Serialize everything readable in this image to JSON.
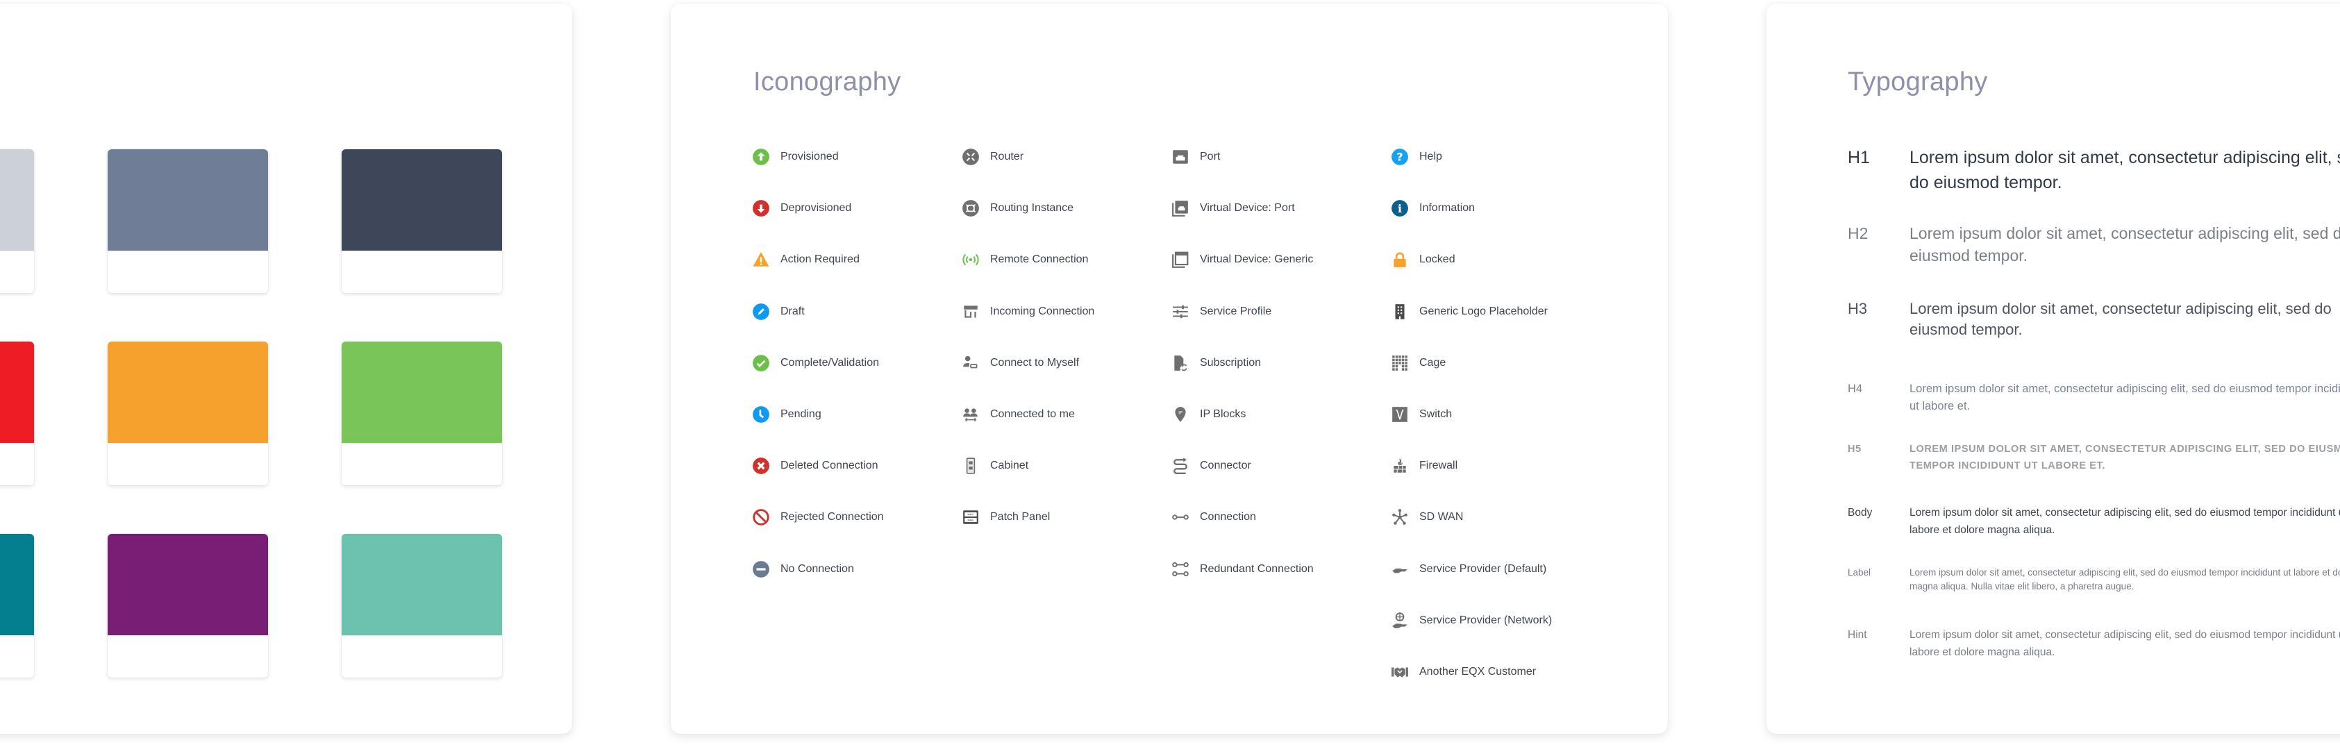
{
  "colors_panel": {
    "swatches": [
      {
        "name": "light-gray",
        "hex": "#CBD0D9"
      },
      {
        "name": "slate",
        "hex": "#6F7E96"
      },
      {
        "name": "dark-slate",
        "hex": "#3E4759"
      },
      {
        "name": "red",
        "hex": "#EE1C25"
      },
      {
        "name": "orange",
        "hex": "#F6A02D"
      },
      {
        "name": "green",
        "hex": "#7AC55A"
      },
      {
        "name": "teal",
        "hex": "#037F8F"
      },
      {
        "name": "purple",
        "hex": "#781E74"
      },
      {
        "name": "mint",
        "hex": "#6CC2AF"
      }
    ]
  },
  "iconography": {
    "title": "Iconography",
    "columns": [
      [
        {
          "label": "Provisioned",
          "icon": "arrow-up-circle-icon",
          "color": "#6CC04A"
        },
        {
          "label": "Deprovisioned",
          "icon": "arrow-down-circle-icon",
          "color": "#D0312D"
        },
        {
          "label": "Action Required",
          "icon": "warning-triangle-icon",
          "color": "#F7A128"
        },
        {
          "label": "Draft",
          "icon": "pencil-circle-icon",
          "color": "#0F9AF0"
        },
        {
          "label": "Complete/Validation",
          "icon": "check-circle-icon",
          "color": "#6CC04A"
        },
        {
          "label": "Pending",
          "icon": "clock-circle-icon",
          "color": "#0F9AF0"
        },
        {
          "label": "Deleted Connection",
          "icon": "x-circle-icon",
          "color": "#D0312D"
        },
        {
          "label": "Rejected Connection",
          "icon": "prohibited-icon",
          "color": "#D0312D"
        },
        {
          "label": "No Connection",
          "icon": "minus-circle-icon",
          "color": "#6B7A90"
        }
      ],
      [
        {
          "label": "Router",
          "icon": "router-icon",
          "color": "#6F6F6F"
        },
        {
          "label": "Routing Instance",
          "icon": "routing-instance-icon",
          "color": "#6F6F6F"
        },
        {
          "label": "Remote Connection",
          "icon": "broadcast-icon",
          "color": "#6CC04A"
        },
        {
          "label": "Incoming Connection",
          "icon": "storefront-icon",
          "color": "#6F6F6F"
        },
        {
          "label": "Connect to Myself",
          "icon": "user-loop-icon",
          "color": "#6F6F6F"
        },
        {
          "label": "Connected to me",
          "icon": "users-arrows-icon",
          "color": "#6F6F6F"
        },
        {
          "label": "Cabinet",
          "icon": "cabinet-icon",
          "color": "#6F6F6F"
        },
        {
          "label": "Patch Panel",
          "icon": "patch-panel-icon",
          "color": "#4A4A4A"
        }
      ],
      [
        {
          "label": "Port",
          "icon": "ethernet-port-icon",
          "color": "#6F6F6F"
        },
        {
          "label": "Virtual Device: Port",
          "icon": "virtual-port-icon",
          "color": "#6F6F6F"
        },
        {
          "label": "Virtual Device: Generic",
          "icon": "virtual-generic-icon",
          "color": "#6F6F6F"
        },
        {
          "label": "Service Profile",
          "icon": "sliders-icon",
          "color": "#6F6F6F"
        },
        {
          "label": "Subscription",
          "icon": "document-refresh-icon",
          "color": "#6F6F6F"
        },
        {
          "label": "IP Blocks",
          "icon": "ip-pin-icon",
          "color": "#6F6F6F"
        },
        {
          "label": "Connector",
          "icon": "connector-icon",
          "color": "#6F6F6F"
        },
        {
          "label": "Connection",
          "icon": "connection-icon",
          "color": "#6F6F6F"
        },
        {
          "label": "Redundant Connection",
          "icon": "redundant-connection-icon",
          "color": "#6F6F6F"
        }
      ],
      [
        {
          "label": "Help",
          "icon": "question-circle-icon",
          "color": "#1AA0F0"
        },
        {
          "label": "Information",
          "icon": "info-circle-icon",
          "color": "#0C5F8C"
        },
        {
          "label": "Locked",
          "icon": "lock-icon",
          "color": "#F7A128"
        },
        {
          "label": "Generic Logo Placeholder",
          "icon": "building-icon",
          "color": "#4A4A4A"
        },
        {
          "label": "Cage",
          "icon": "cage-grid-icon",
          "color": "#6F6F6F"
        },
        {
          "label": "Switch",
          "icon": "switch-icon",
          "color": "#6F6F6F"
        },
        {
          "label": "Firewall",
          "icon": "firewall-icon",
          "color": "#6F6F6F"
        },
        {
          "label": "SD WAN",
          "icon": "sd-wan-hub-icon",
          "color": "#6F6F6F"
        },
        {
          "label": "Service Provider (Default)",
          "icon": "hand-icon",
          "color": "#6F6F6F"
        },
        {
          "label": "Service Provider (Network)",
          "icon": "hand-globe-icon",
          "color": "#6F6F6F"
        },
        {
          "label": "Another EQX Customer",
          "icon": "handshake-icon",
          "color": "#6F6F6F"
        }
      ]
    ]
  },
  "typography": {
    "title": "Typography",
    "rows": [
      {
        "key": "h1",
        "label": "H1",
        "sample": "Lorem ipsum dolor sit amet, consectetur adipiscing elit, sed do eiusmod tempor."
      },
      {
        "key": "h2",
        "label": "H2",
        "sample": "Lorem ipsum dolor sit amet, consectetur adipiscing elit, sed do eiusmod tempor."
      },
      {
        "key": "h3",
        "label": "H3",
        "sample": "Lorem ipsum dolor sit amet, consectetur adipiscing elit, sed do eiusmod tempor."
      },
      {
        "key": "h4",
        "label": "H4",
        "sample": "Lorem ipsum dolor sit amet, consectetur adipiscing elit, sed do eiusmod tempor incididunt ut labore et."
      },
      {
        "key": "h5",
        "label": "H5",
        "sample": "LOREM IPSUM DOLOR SIT AMET, CONSECTETUR ADIPISCING ELIT, SED DO EIUSMOD TEMPOR INCIDIDUNT UT LABORE ET."
      },
      {
        "key": "body",
        "label": "Body",
        "sample": "Lorem ipsum dolor sit amet, consectetur adipiscing elit, sed do eiusmod tempor incididunt ut labore et dolore magna aliqua."
      },
      {
        "key": "label",
        "label": "Label",
        "sample": "Lorem ipsum dolor sit amet, consectetur adipiscing elit, sed do eiusmod tempor incididunt ut labore et dolore magna aliqua. Nulla vitae elit libero, a pharetra augue."
      },
      {
        "key": "hint",
        "label": "Hint",
        "sample": "Lorem ipsum dolor sit amet, consectetur adipiscing elit, sed do eiusmod tempor incididunt ut labore et dolore magna aliqua."
      }
    ]
  }
}
